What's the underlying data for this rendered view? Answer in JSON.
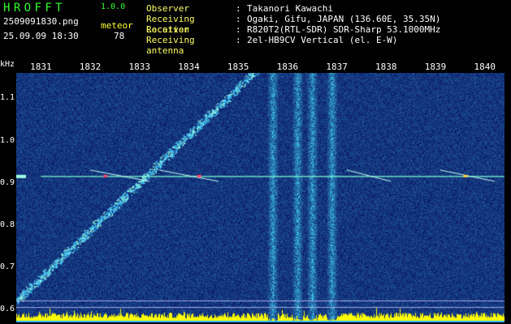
{
  "app": {
    "name": "HROFFT",
    "version": "1.0.0"
  },
  "file": {
    "name": "2509091830.png",
    "datetime": "25.09.09 18:30"
  },
  "meteor": {
    "label": "meteor",
    "count": "78"
  },
  "info": [
    {
      "key": "Observer",
      "value": "Takanori Kawachi"
    },
    {
      "key": "Receiving Location",
      "value": "Ogaki, Gifu, JAPAN (136.60E, 35.35N)"
    },
    {
      "key": "Receiver",
      "value": "R820T2(RTL-SDR) SDR-Sharp 53.1000MHz"
    },
    {
      "key": "Receiving antenna",
      "value": "2el-HB9CV Vertical (el. E-W)"
    }
  ],
  "colors": {
    "background": "#000000",
    "plot_bg": "#0a1a6e",
    "header_key": "#ffff66",
    "logo": "#33ff33",
    "signal": "#7fffd4",
    "floor_bars": "#ffff00"
  },
  "axes": {
    "y_unit": "kHz",
    "y_ticks": [
      "1.1",
      "1.0",
      "0.9",
      "0.8",
      "0.7",
      "0.6"
    ],
    "x_ticks": [
      "1831",
      "1832",
      "1833",
      "1834",
      "1835",
      "1836",
      "1837",
      "1838",
      "1839",
      "1840"
    ]
  },
  "chart_data": {
    "type": "heatmap",
    "xlabel": "",
    "ylabel": "kHz",
    "x_range": [
      1830.5,
      1840.4
    ],
    "y_range": [
      0.57,
      1.16
    ],
    "x_ticks": [
      1831,
      1832,
      1833,
      1834,
      1835,
      1836,
      1837,
      1838,
      1839,
      1840
    ],
    "y_ticks": [
      1.1,
      1.0,
      0.9,
      0.8,
      0.7,
      0.6
    ],
    "carrier_khz": 0.915,
    "vertical_bands_x": [
      1835.7,
      1836.2,
      1836.5,
      1836.9
    ],
    "rising_trace": {
      "from": [
        1830.5,
        0.62
      ],
      "to": [
        1835.4,
        1.17
      ]
    }
  }
}
